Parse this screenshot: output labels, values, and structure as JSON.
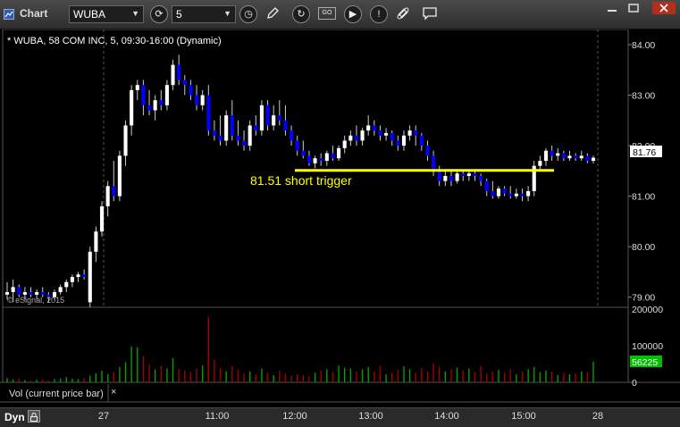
{
  "titlebar": {
    "app_title": "Chart",
    "symbol": "WUBA",
    "interval": "5"
  },
  "chart": {
    "header": "* WUBA, 58 COM INC, 5, 09:30-16:00 (Dynamic)",
    "copyright": "© eSignal, 2015",
    "price_axis": {
      "ticks": [
        "84.00",
        "83.00",
        "82.00",
        "81.00",
        "80.00",
        "79.00"
      ],
      "last_price": "81.76"
    },
    "volume_axis": {
      "ticks": [
        "200000",
        "100000",
        "0"
      ],
      "last_volume": "56225"
    },
    "volume_label": "Vol (current price bar)",
    "volume_close": "×",
    "annotation": "81.51 short trigger",
    "time_axis": [
      "27",
      "11:00",
      "12:00",
      "13:00",
      "14:00",
      "15:00",
      "28"
    ],
    "colors": {
      "up": "#ffffff",
      "down": "#0000ff",
      "trigger": "#ffff00",
      "price_badge": "#ffffff",
      "volume_badge": "#00c000",
      "vol_up": "#00a000",
      "vol_down": "#a00000"
    }
  },
  "chart_data": {
    "type": "candlestick",
    "y_range": [
      78.8,
      84.3
    ],
    "trigger_level": 81.51,
    "candles": [
      [
        79.05,
        79.3,
        78.95,
        79.1
      ],
      [
        79.1,
        79.35,
        78.9,
        79.2
      ],
      [
        79.2,
        79.25,
        79.0,
        79.05
      ],
      [
        79.05,
        79.2,
        78.95,
        79.1
      ],
      [
        79.1,
        79.2,
        79.0,
        79.05
      ],
      [
        79.05,
        79.15,
        78.95,
        79.1
      ],
      [
        79.1,
        79.2,
        79.0,
        79.05
      ],
      [
        79.05,
        79.1,
        78.9,
        79.0
      ],
      [
        79.0,
        79.15,
        78.95,
        79.1
      ],
      [
        79.1,
        79.25,
        79.05,
        79.2
      ],
      [
        79.2,
        79.35,
        79.1,
        79.3
      ],
      [
        79.3,
        79.45,
        79.2,
        79.4
      ],
      [
        79.4,
        79.5,
        79.3,
        79.45
      ],
      [
        79.45,
        79.55,
        79.35,
        79.4
      ],
      [
        78.9,
        80.0,
        78.8,
        79.9
      ],
      [
        79.9,
        80.4,
        79.7,
        80.3
      ],
      [
        80.3,
        80.9,
        80.2,
        80.8
      ],
      [
        80.8,
        81.3,
        80.6,
        81.2
      ],
      [
        81.2,
        81.7,
        80.9,
        81.0
      ],
      [
        81.0,
        81.9,
        80.9,
        81.8
      ],
      [
        81.8,
        82.5,
        81.6,
        82.4
      ],
      [
        82.4,
        83.2,
        82.2,
        83.1
      ],
      [
        83.1,
        83.3,
        82.9,
        83.2
      ],
      [
        83.2,
        83.3,
        82.6,
        82.8
      ],
      [
        82.8,
        83.1,
        82.6,
        82.7
      ],
      [
        82.7,
        83.0,
        82.5,
        82.9
      ],
      [
        82.9,
        83.1,
        82.7,
        82.8
      ],
      [
        82.8,
        83.3,
        82.7,
        83.2
      ],
      [
        83.2,
        83.7,
        83.1,
        83.6
      ],
      [
        83.6,
        83.8,
        83.2,
        83.3
      ],
      [
        83.3,
        83.4,
        83.0,
        83.2
      ],
      [
        83.2,
        83.3,
        82.9,
        83.0
      ],
      [
        83.0,
        83.2,
        82.7,
        82.8
      ],
      [
        82.8,
        83.1,
        82.7,
        83.0
      ],
      [
        83.0,
        83.2,
        82.2,
        82.3
      ],
      [
        82.3,
        82.5,
        82.1,
        82.2
      ],
      [
        82.2,
        82.6,
        82.0,
        82.1
      ],
      [
        82.1,
        82.7,
        82.0,
        82.6
      ],
      [
        82.6,
        82.9,
        82.1,
        82.2
      ],
      [
        82.2,
        82.5,
        82.0,
        82.1
      ],
      [
        82.1,
        82.3,
        81.9,
        82.0
      ],
      [
        82.0,
        82.5,
        81.9,
        82.4
      ],
      [
        82.4,
        82.6,
        82.2,
        82.3
      ],
      [
        82.3,
        82.9,
        82.2,
        82.8
      ],
      [
        82.8,
        82.9,
        82.3,
        82.4
      ],
      [
        82.4,
        82.8,
        82.3,
        82.6
      ],
      [
        82.6,
        82.9,
        82.4,
        82.5
      ],
      [
        82.5,
        82.8,
        82.2,
        82.3
      ],
      [
        82.3,
        82.4,
        82.0,
        82.1
      ],
      [
        82.1,
        82.2,
        81.8,
        81.9
      ],
      [
        81.9,
        82.1,
        81.75,
        81.8
      ],
      [
        81.8,
        81.9,
        81.6,
        81.65
      ],
      [
        81.65,
        81.8,
        81.55,
        81.75
      ],
      [
        81.75,
        81.85,
        81.6,
        81.7
      ],
      [
        81.7,
        81.9,
        81.6,
        81.85
      ],
      [
        81.85,
        82.0,
        81.7,
        81.75
      ],
      [
        81.75,
        82.0,
        81.7,
        81.95
      ],
      [
        81.95,
        82.2,
        81.85,
        82.1
      ],
      [
        82.1,
        82.3,
        82.0,
        82.2
      ],
      [
        82.2,
        82.4,
        82.0,
        82.1
      ],
      [
        82.1,
        82.35,
        82.0,
        82.3
      ],
      [
        82.3,
        82.6,
        82.2,
        82.4
      ],
      [
        82.4,
        82.5,
        82.2,
        82.3
      ],
      [
        82.3,
        82.4,
        82.1,
        82.2
      ],
      [
        82.2,
        82.35,
        82.1,
        82.25
      ],
      [
        82.25,
        82.3,
        82.0,
        82.1
      ],
      [
        82.1,
        82.2,
        81.9,
        82.0
      ],
      [
        82.0,
        82.3,
        81.9,
        82.2
      ],
      [
        82.2,
        82.4,
        82.1,
        82.3
      ],
      [
        82.3,
        82.4,
        82.0,
        82.2
      ],
      [
        82.2,
        82.25,
        81.9,
        82.0
      ],
      [
        82.0,
        82.1,
        81.7,
        81.8
      ],
      [
        81.8,
        81.9,
        81.4,
        81.5
      ],
      [
        81.5,
        81.6,
        81.2,
        81.3
      ],
      [
        81.3,
        81.5,
        81.2,
        81.4
      ],
      [
        81.4,
        81.5,
        81.2,
        81.3
      ],
      [
        81.3,
        81.5,
        81.25,
        81.45
      ],
      [
        81.45,
        81.5,
        81.3,
        81.4
      ],
      [
        81.4,
        81.5,
        81.3,
        81.45
      ],
      [
        81.45,
        81.5,
        81.3,
        81.4
      ],
      [
        81.4,
        81.45,
        81.2,
        81.3
      ],
      [
        81.3,
        81.35,
        81.0,
        81.1
      ],
      [
        81.1,
        81.3,
        80.95,
        81.0
      ],
      [
        81.0,
        81.2,
        80.95,
        81.15
      ],
      [
        81.15,
        81.2,
        81.0,
        81.05
      ],
      [
        81.05,
        81.2,
        80.95,
        81.0
      ],
      [
        81.0,
        81.15,
        80.95,
        81.05
      ],
      [
        81.05,
        81.15,
        80.9,
        81.0
      ],
      [
        81.0,
        81.2,
        80.9,
        81.1
      ],
      [
        81.1,
        81.7,
        81.0,
        81.6
      ],
      [
        81.6,
        81.8,
        81.5,
        81.7
      ],
      [
        81.7,
        81.95,
        81.6,
        81.9
      ],
      [
        81.9,
        82.0,
        81.7,
        81.8
      ],
      [
        81.8,
        81.95,
        81.7,
        81.85
      ],
      [
        81.85,
        81.9,
        81.7,
        81.75
      ],
      [
        81.75,
        81.9,
        81.7,
        81.8
      ],
      [
        81.8,
        81.85,
        81.7,
        81.75
      ],
      [
        81.75,
        81.9,
        81.7,
        81.8
      ],
      [
        81.8,
        81.85,
        81.65,
        81.7
      ],
      [
        81.7,
        81.8,
        81.65,
        81.76
      ]
    ],
    "volume_y_range": [
      0,
      200000
    ],
    "volume": [
      12000,
      8000,
      10000,
      6000,
      5000,
      7000,
      8000,
      6000,
      9000,
      11000,
      14000,
      10000,
      9000,
      12000,
      18000,
      25000,
      32000,
      22000,
      28000,
      42000,
      55000,
      98000,
      96000,
      72000,
      48000,
      35000,
      45000,
      38000,
      66000,
      36000,
      32000,
      28000,
      38000,
      46000,
      178000,
      62000,
      40000,
      30000,
      44000,
      36000,
      24000,
      30000,
      22000,
      38000,
      26000,
      20000,
      32000,
      24000,
      18000,
      22000,
      20000,
      16000,
      26000,
      32000,
      36000,
      28000,
      46000,
      40000,
      38000,
      30000,
      36000,
      42000,
      30000,
      44000,
      22000,
      26000,
      34000,
      44000,
      36000,
      26000,
      40000,
      30000,
      52000,
      42000,
      30000,
      36000,
      40000,
      32000,
      38000,
      28000,
      44000,
      24000,
      30000,
      34000,
      26000,
      36000,
      22000,
      30000,
      36000,
      42000,
      28000,
      32000,
      30000,
      20000,
      26000,
      22000,
      24000,
      30000,
      28000,
      56225
    ]
  }
}
